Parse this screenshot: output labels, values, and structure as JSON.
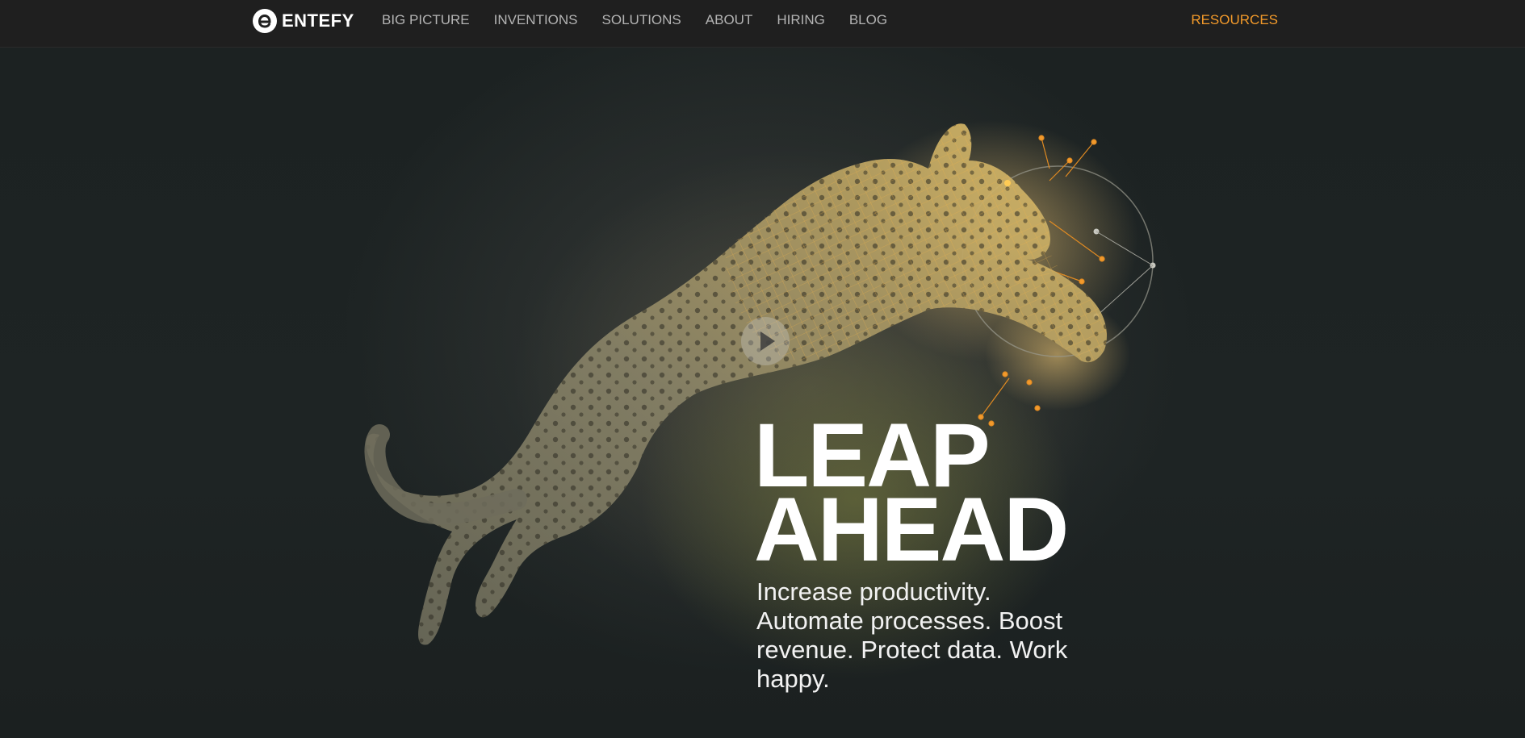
{
  "nav": {
    "logo_text": "ENTEFY",
    "links": [
      "BIG PICTURE",
      "INVENTIONS",
      "SOLUTIONS",
      "ABOUT",
      "HIRING",
      "BLOG"
    ],
    "resources": "RESOURCES"
  },
  "hero": {
    "headline_line1": "LEAP",
    "headline_line2": "AHEAD",
    "subheadline": "Increase productivity. Automate processes. Boost revenue. Protect data. Work happy."
  },
  "icons": {
    "logo": "entefy-e-icon",
    "play": "play-icon",
    "scroll": "chevron-down-icon"
  },
  "colors": {
    "accent": "#f39a2a",
    "nav_bg": "#1f1f1f",
    "hero_text": "#ffffff",
    "nav_text": "#b4b4b4"
  }
}
